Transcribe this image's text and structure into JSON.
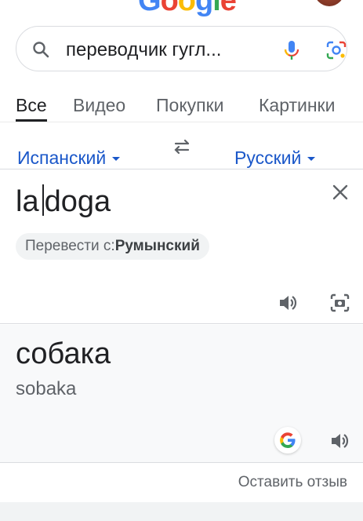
{
  "header": {
    "logo_letters": [
      "G",
      "o",
      "o",
      "g",
      "l",
      "e"
    ],
    "logo_colors": [
      "#4285f4",
      "#ea4335",
      "#fbbc05",
      "#4285f4",
      "#34a853",
      "#ea4335"
    ]
  },
  "search": {
    "query": "переводчик гугл..."
  },
  "tabs": [
    {
      "label": "Все",
      "active": true
    },
    {
      "label": "Видео",
      "active": false
    },
    {
      "label": "Покупки",
      "active": false
    },
    {
      "label": "Картинки",
      "active": false
    }
  ],
  "translator": {
    "source_language": "Испанский",
    "target_language": "Русский",
    "source_text_before_cursor": "la",
    "source_text_after_cursor": "doga",
    "detect_prefix": "Перевести с:",
    "detect_language": "Румынский",
    "translation": "собака",
    "transliteration": "sobaka",
    "feedback_label": "Оставить отзыв"
  },
  "colors": {
    "link_blue": "#1a57c9",
    "icon_gray": "#5f6368",
    "text_dark": "#202124",
    "translation_bg": "#f8f9fa"
  },
  "icons": [
    "search-icon",
    "mic-icon",
    "lens-icon",
    "swap-icon",
    "clear-icon",
    "speaker-icon",
    "camera-icon",
    "google-g-icon"
  ]
}
